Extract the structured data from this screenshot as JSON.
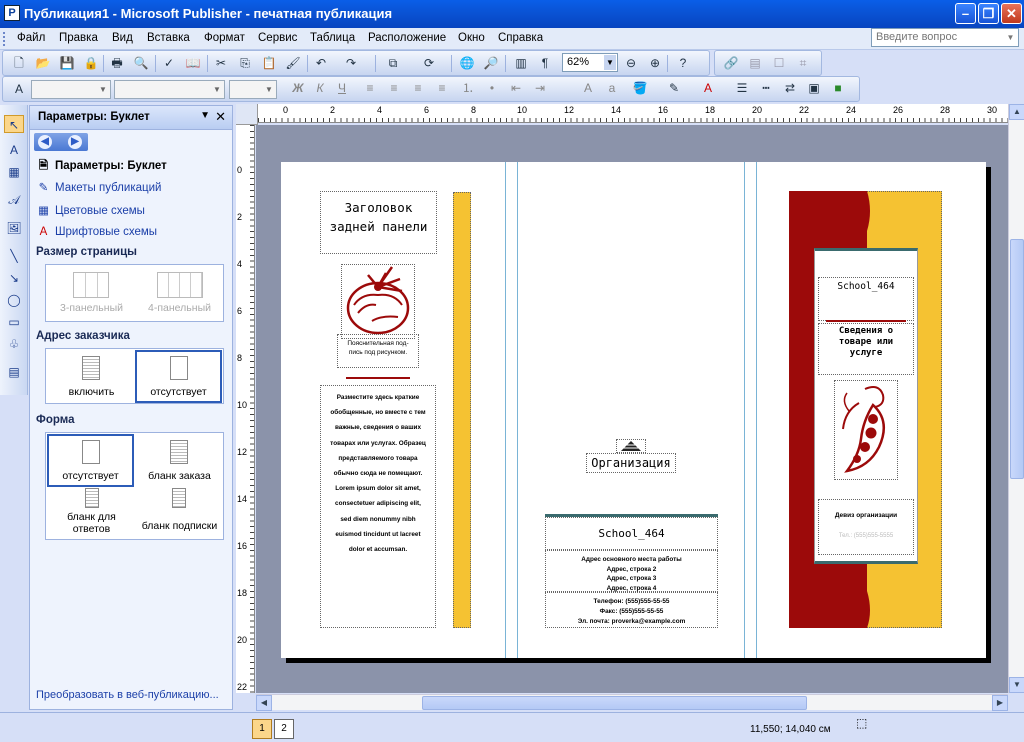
{
  "window": {
    "title": "Публикация1 - Microsoft Publisher - печатная публикация",
    "app_icon": "P"
  },
  "menu": {
    "items": [
      "Файл",
      "Правка",
      "Вид",
      "Вставка",
      "Формат",
      "Сервис",
      "Таблица",
      "Расположение",
      "Окно",
      "Справка"
    ],
    "help_placeholder": "Введите вопрос"
  },
  "toolbar": {
    "zoom": "62%",
    "format_letters": [
      "Ж",
      "К",
      "Ч"
    ]
  },
  "taskpane": {
    "title": "Параметры: Буклет",
    "links": [
      {
        "label": "Параметры: Буклет",
        "icon": "document-icon"
      },
      {
        "label": "Макеты публикаций",
        "icon": "layout-icon"
      },
      {
        "label": "Цветовые схемы",
        "icon": "color-grid-icon"
      },
      {
        "label": "Шрифтовые схемы",
        "icon": "font-icon"
      }
    ],
    "page_size": {
      "heading": "Размер страницы",
      "options": [
        "3-панельный",
        "4-панельный"
      ]
    },
    "customer_address": {
      "heading": "Адрес заказчика",
      "options": [
        "включить",
        "отсутствует"
      ],
      "selected": "отсутствует"
    },
    "form": {
      "heading": "Форма",
      "options": [
        "отсутствует",
        "бланк заказа",
        "бланк для ответов",
        "бланк подписки"
      ],
      "selected": "отсутствует"
    },
    "footer_link": "Преобразовать в веб-публикацию..."
  },
  "rulers": {
    "horizontal": [
      "0",
      "2",
      "4",
      "6",
      "8",
      "10",
      "12",
      "14",
      "16",
      "18",
      "20",
      "22",
      "24",
      "26",
      "28",
      "30"
    ],
    "vertical": [
      "0",
      "2",
      "4",
      "6",
      "8",
      "10",
      "12",
      "14",
      "16",
      "18",
      "20",
      "22"
    ]
  },
  "publication": {
    "back_panel_title": [
      "Заголовок",
      "задней панели"
    ],
    "caption": [
      "Пояснительная под-",
      "пись под рисунком."
    ],
    "back_body": [
      "Разместите здесь краткие",
      "обобщенные, но вместе с тем",
      "важные, сведения о ваших",
      "товарах или услугах. Образец",
      "представляемого товара",
      "обычно сюда не помещают.",
      "Lorem ipsum dolor sit amet,",
      "consectetuer adipiscing elit,",
      "sed diem nonummy nibh",
      "euismod tincidunt ut lacreet",
      "dolor et accumsan."
    ],
    "organization": "Организация",
    "org_name": "School_464",
    "address": [
      "Адрес основного места работы",
      "Адрес, строка 2",
      "Адрес, строка 3",
      "Адрес, строка 4"
    ],
    "contacts": [
      "Телефон: (555)555-55-55",
      "Факс: (555)555-55-55",
      "Эл. почта: proverka@example.com"
    ],
    "cover_name": "School_464",
    "cover_heading": [
      "Сведения о",
      "товаре или",
      "услуге"
    ],
    "motto": "Девиз организации",
    "cover_phone": "Тел.: (555)555-5555",
    "colors": {
      "dark_red": "#9c0a0a",
      "yellow": "#f5c232",
      "teal_rule": "#3a6b6e"
    }
  },
  "status": {
    "pages": [
      "1",
      "2"
    ],
    "current_page": "1",
    "coordinates": "11,550; 14,040 см"
  }
}
